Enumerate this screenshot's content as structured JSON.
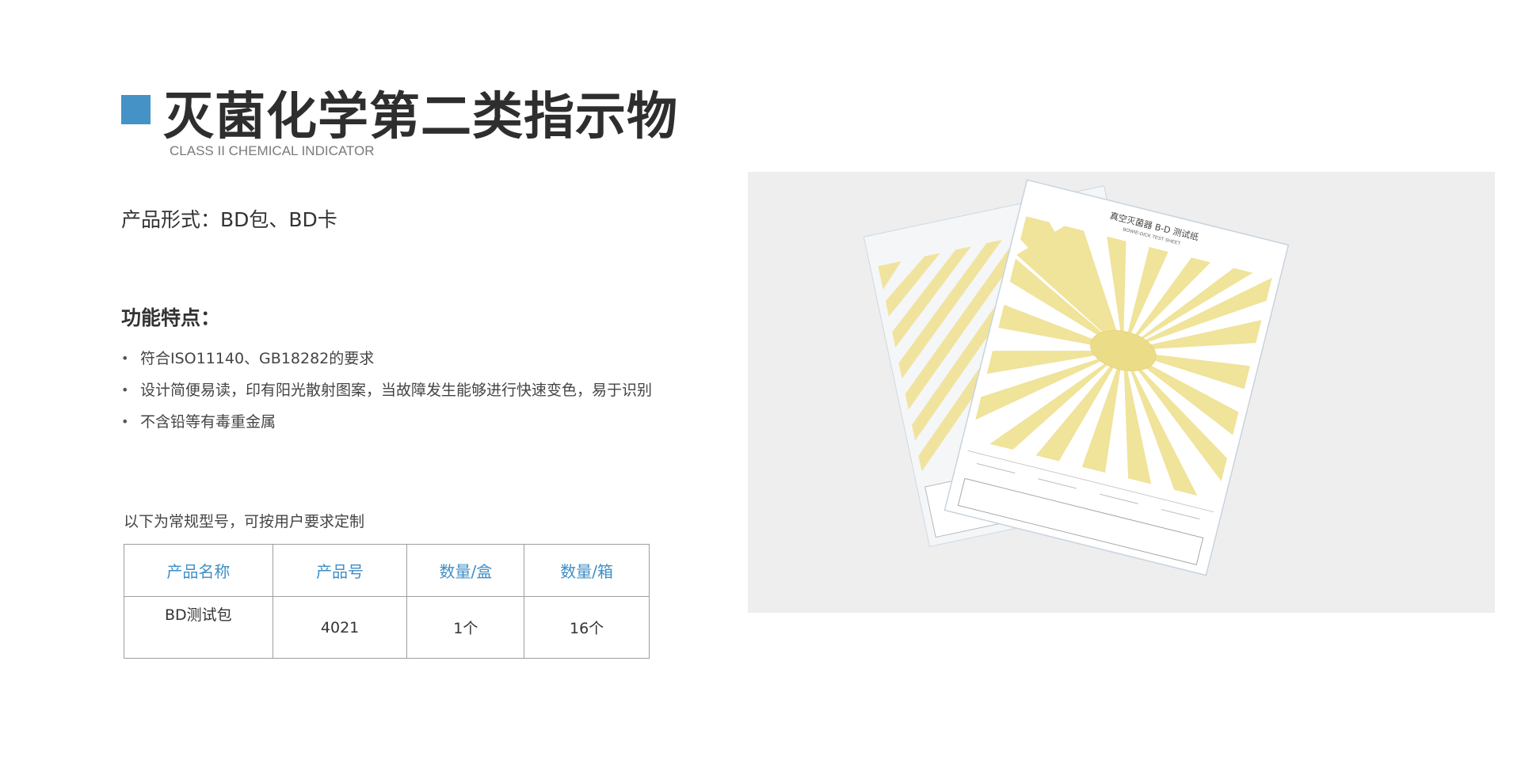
{
  "header": {
    "title": "灭菌化学第二类指示物",
    "subtitle": "CLASS II CHEMICAL INDICATOR",
    "accent_color": "#4592c6"
  },
  "product_form": {
    "text": "产品形式：BD包、BD卡"
  },
  "features": {
    "heading": "功能特点：",
    "bullet": "•",
    "items": [
      "符合ISO11140、GB18282的要求",
      "设计简便易读，印有阳光散射图案，当故障发生能够进行快速变色，易于识别",
      "不含铅等有毒重金属"
    ]
  },
  "spec_table": {
    "note": "以下为常规型号，可按用户要求定制",
    "header_color": "#3f8ec6",
    "columns": [
      "产品名称",
      "产品号",
      "数量/盒",
      "数量/箱"
    ],
    "rows": [
      [
        "BD测试包",
        "4021",
        "1个",
        "16个"
      ]
    ]
  },
  "photo": {
    "sheet_title": "真空灭菌器 B-D 测试纸",
    "sheet_subtitle": "BOWIE-DICK TEST SHEET",
    "pattern_color": "#f0e39a"
  }
}
